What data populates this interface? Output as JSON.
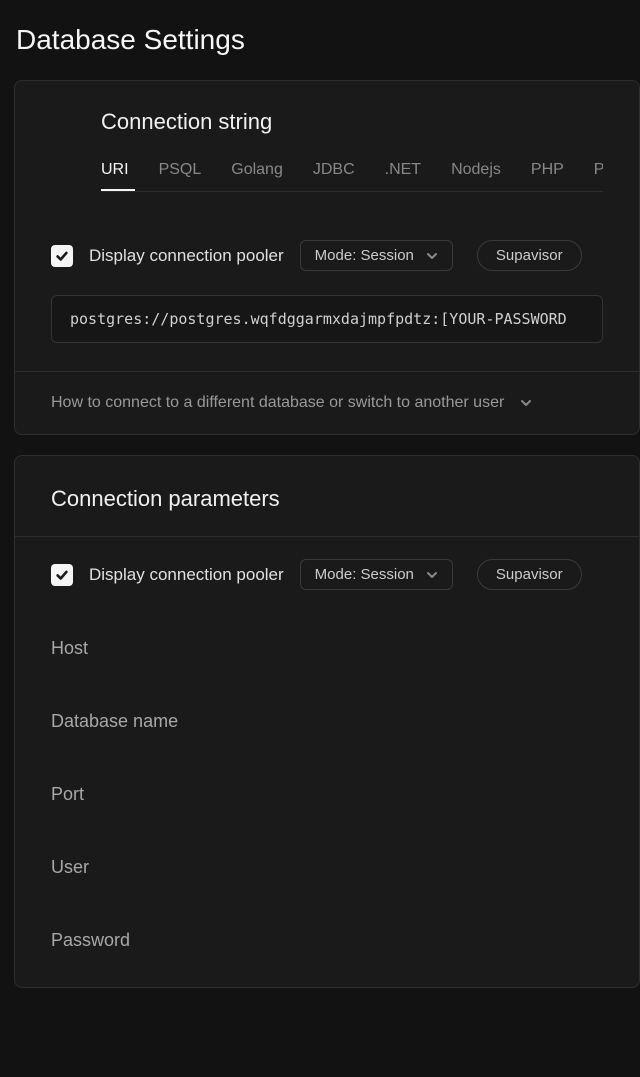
{
  "page_title": "Database Settings",
  "connection_string": {
    "title": "Connection string",
    "tabs": [
      "URI",
      "PSQL",
      "Golang",
      "JDBC",
      ".NET",
      "Nodejs",
      "PHP",
      "Python"
    ],
    "active_tab": "URI",
    "display_pooler_label": "Display connection pooler",
    "display_pooler_checked": true,
    "mode_label": "Mode: Session",
    "supavisor_label": "Supavisor",
    "connection_value": "postgres://postgres.wqfdggarmxdajmpfpdtz:[YOUR-PASSWORD",
    "footer_text": "How to connect to a different database or switch to another user"
  },
  "connection_params": {
    "title": "Connection parameters",
    "display_pooler_label": "Display connection pooler",
    "display_pooler_checked": true,
    "mode_label": "Mode: Session",
    "supavisor_label": "Supavisor",
    "fields": {
      "host": "Host",
      "database_name": "Database name",
      "port": "Port",
      "user": "User",
      "password": "Password"
    }
  }
}
